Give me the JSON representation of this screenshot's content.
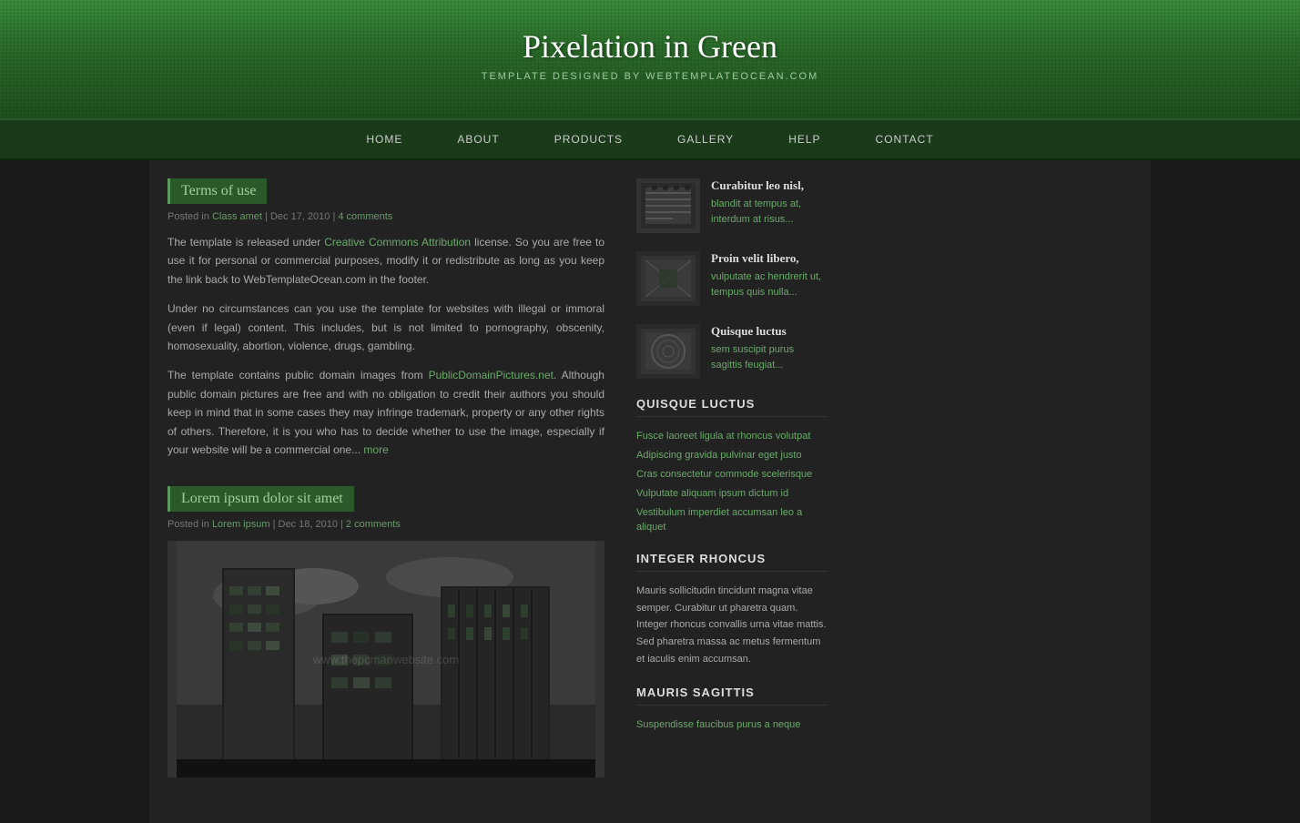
{
  "site": {
    "title": "Pixelation in Green",
    "subtitle": "TEMPLATE DESIGNED BY WEBTEMPLATEOCEAN.COM"
  },
  "nav": {
    "items": [
      {
        "label": "HOME",
        "href": "#"
      },
      {
        "label": "ABOUT",
        "href": "#"
      },
      {
        "label": "PRODUCTS",
        "href": "#"
      },
      {
        "label": "GALLERY",
        "href": "#"
      },
      {
        "label": "HELP",
        "href": "#"
      },
      {
        "label": "CONTACT",
        "href": "#"
      }
    ]
  },
  "posts": [
    {
      "title": "Terms of use",
      "meta_prefix": "Posted in",
      "category": "Class amet",
      "date": "Dec 17, 2010",
      "comments": "4 comments",
      "body_p1": "The template is released under Creative Commons Attribution license. So you are free to use it for personal or commercial purposes, modify it or redistribute as long as you keep the link back to WebTemplateOcean.com in the footer.",
      "body_p2": "Under no circumstances can you use the template for websites with illegal or immoral (even if legal) content. This includes, but is not limited to pornography, obscenity, homosexuality, abortion, violence, drugs, gambling.",
      "body_p3": "The template contains public domain images from PublicDomainPictures.net. Although public domain pictures are free and with no obligation to credit their authors you should keep in mind that in some cases they may infringe trademark, property or any other rights of others. Therefore, it is you who has to decide whether to use the image, especially if your website will be a commercial one...",
      "more_label": "more"
    },
    {
      "title": "Lorem ipsum dolor sit amet",
      "meta_prefix": "Posted in",
      "category": "Lorem ipsum",
      "date": "Dec 18, 2010",
      "comments": "2 comments"
    }
  ],
  "sidebar": {
    "items": [
      {
        "title": "Curabitur leo nisl,",
        "link1": "blandit at tempus at,",
        "link2": "interdum at risus..."
      },
      {
        "title": "Proin velit libero,",
        "link1": "vulputate ac hendrerit ut,",
        "link2": "tempus quis nulla..."
      },
      {
        "title": "Quisque luctus",
        "link1": "sem suscipit purus",
        "link2": "sagittis feugiat..."
      }
    ],
    "section1_title": "QUISQUE LUCTUS",
    "section1_links": [
      "Fusce laoreet ligula at rhoncus volutpat",
      "Adipiscing gravida pulvinar eget justo",
      "Cras consectetur commode scelerisque",
      "Vulputate aliquam ipsum dictum id",
      "Vestibulum imperdiet accumsan leo a aliquet"
    ],
    "section2_title": "INTEGER RHONCUS",
    "section2_text": "Mauris sollicitudin tincidunt magna vitae semper. Curabitur ut pharetra quam. Integer rhoncus convallis urna vitae mattis. Sed pharetra massa ac metus fermentum et iaculis enim accumsan.",
    "section3_title": "MAURIS SAGITTIS",
    "section3_link": "Suspendisse faucibus purus a neque"
  },
  "watermark": "www.thepcmanwebsite.com"
}
